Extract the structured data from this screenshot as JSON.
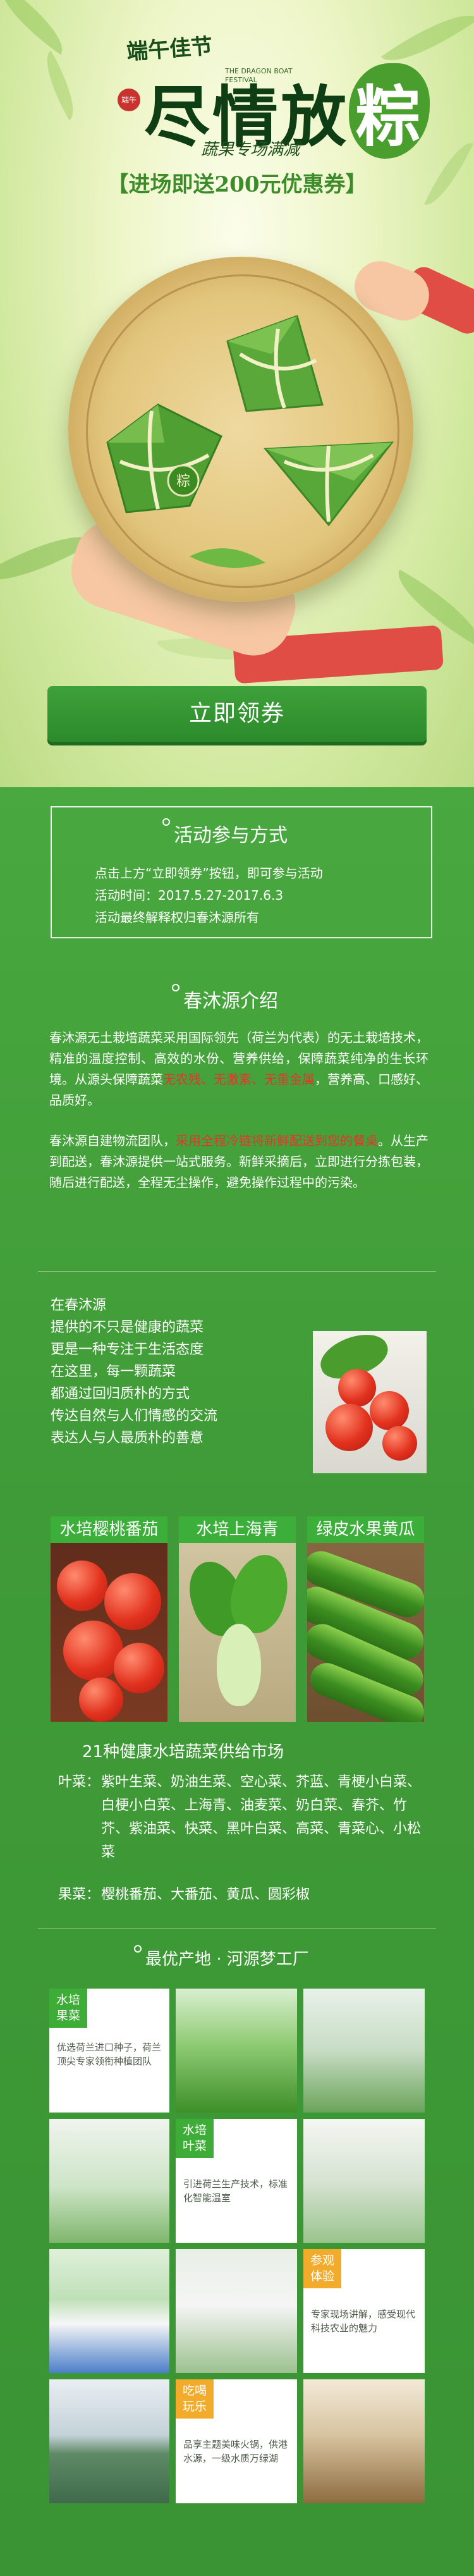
{
  "hero": {
    "brand_small": "端午佳节",
    "seal": "端午",
    "title_main_prefix": "尽情放",
    "title_main_highlight": "粽",
    "title_en": "THE DRAGON BOAT FESTIVAL",
    "subtitle": "蔬果专场满减",
    "promo": "【进场即送200元优惠券】",
    "zongzi_mark": "粽",
    "cta_label": "立即领券"
  },
  "activity": {
    "title": "活动参与方式",
    "lines": [
      "点击上方“立即领券”按钮，即可参与活动",
      "活动时间：2017.5.27-2017.6.3",
      "活动最终解释权归春沐源所有"
    ]
  },
  "intro": {
    "title": "春沐源介绍",
    "p1_parts": [
      "春沐源无土栽培蔬菜采用国际领先（荷兰为代表）的无土栽培技术，精准的温度控制、高效的水份、营养供给，保障蔬菜纯净的生长环境。从源头保障蔬菜",
      "无农残、无激素、无重金属",
      "，营养高、口感好、品质好。"
    ],
    "p2_parts": [
      "春沐源自建物流团队，",
      "采用全程冷链将新鲜配送到您的餐桌",
      "。从生产到配送，春沐源提供一站式服务。新鲜采摘后，立即进行分拣包装，随后进行配送，全程无尘操作，避免操作过程中的污染。"
    ]
  },
  "promise": {
    "lines": [
      "在春沐源",
      "提供的不只是健康的蔬菜",
      "更是一种专注于生活态度",
      "在这里，每一颗蔬菜",
      "都通过回归质朴的方式",
      "传达自然与人们情感的交流",
      "表达人与人最质朴的善意"
    ]
  },
  "veggies": [
    {
      "label": "水培樱桃番茄"
    },
    {
      "label": "水培上海青"
    },
    {
      "label": "绿皮水果黄瓜"
    }
  ],
  "market": {
    "title": "21种健康水培蔬菜供给市场",
    "leaf_label": "叶菜：",
    "leaf_items": "紫叶生菜、奶油生菜、空心菜、芥蓝、青梗小白菜、白梗小白菜、上海青、油麦菜、奶白菜、春芥、竹芥、紫油菜、快菜、黑叶白菜、高菜、青菜心、小松菜",
    "fruit_label": "果菜：",
    "fruit_items": "樱桃番茄、大番茄、黄瓜、圆彩椒"
  },
  "origin": {
    "title": "最优产地 · 河源梦工厂",
    "cards": [
      {
        "tag": "水培\n果菜",
        "text": "优选荷兰进口种子，荷兰顶尖专家领衔种植团队"
      },
      {
        "tag": "水培\n叶菜",
        "text": "引进荷兰生产技术，标准化智能温室"
      },
      {
        "tag": "参观\n体验",
        "text": "专家现场讲解，感受现代科技农业的魅力"
      },
      {
        "tag": "吃喝\n玩乐",
        "text": "品享主题美味火锅，供港水源，一级水质万绿湖"
      }
    ]
  },
  "colors": {
    "brand_green": "#3e9a3a",
    "button_green": "#2c8a2b",
    "accent_red": "#e8342c",
    "tag_orange": "#f2ab2a"
  }
}
